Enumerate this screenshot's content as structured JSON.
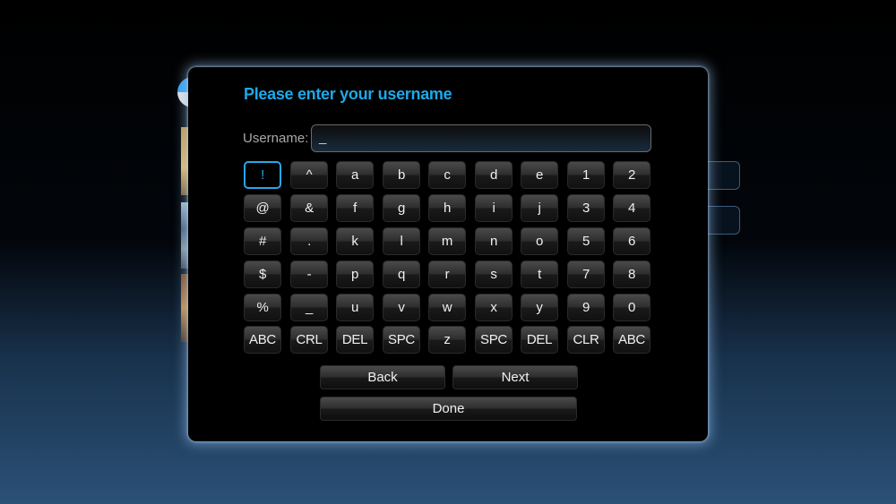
{
  "background": {
    "thumbnails": [
      "thumb-1",
      "thumb-2",
      "thumb-3"
    ]
  },
  "dialog": {
    "prompt": "Please enter your username",
    "field_label": "Username:",
    "field_value": "_",
    "focused_key": "!",
    "keys": [
      [
        "!",
        "^",
        "a",
        "b",
        "c",
        "d",
        "e",
        "1",
        "2"
      ],
      [
        "@",
        "&",
        "f",
        "g",
        "h",
        "i",
        "j",
        "3",
        "4"
      ],
      [
        "#",
        ".",
        "k",
        "l",
        "m",
        "n",
        "o",
        "5",
        "6"
      ],
      [
        "$",
        "-",
        "p",
        "q",
        "r",
        "s",
        "t",
        "7",
        "8"
      ],
      [
        "%",
        "_",
        "u",
        "v",
        "w",
        "x",
        "y",
        "9",
        "0"
      ],
      [
        "ABC",
        "CRL",
        "DEL",
        "SPC",
        "z",
        "SPC",
        "DEL",
        "CLR",
        "ABC"
      ]
    ],
    "buttons": {
      "back": "Back",
      "next": "Next",
      "done": "Done"
    }
  },
  "colors": {
    "accent": "#1da9e8",
    "dialog_glow": "#96c3f0",
    "background_bottom": "#2b5177"
  }
}
